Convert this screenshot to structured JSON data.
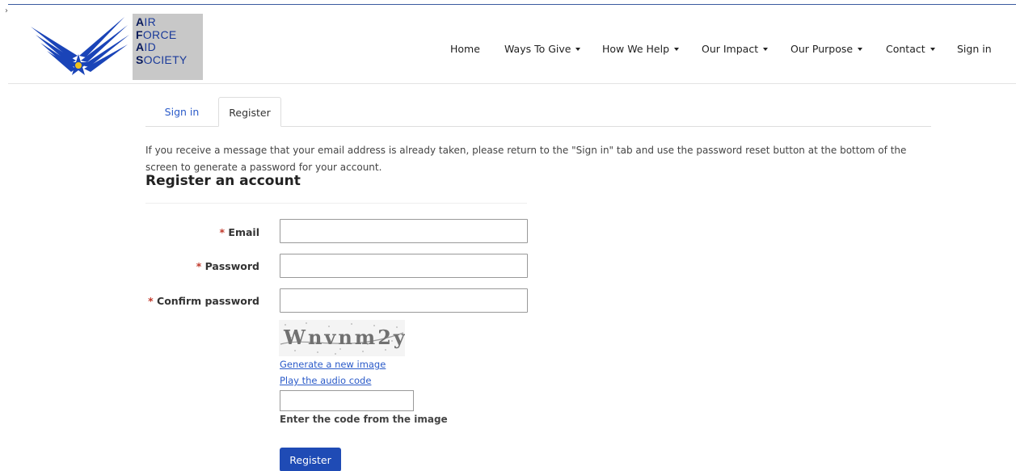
{
  "logo": {
    "lines": [
      {
        "cap": "A",
        "rest": "IR"
      },
      {
        "cap": "F",
        "rest": "ORCE"
      },
      {
        "cap": "A",
        "rest": "ID"
      },
      {
        "cap": "S",
        "rest": "OCIETY"
      }
    ]
  },
  "nav": {
    "items": [
      {
        "label": "Home",
        "dropdown": false
      },
      {
        "label": "Ways To Give",
        "dropdown": true
      },
      {
        "label": "How We Help",
        "dropdown": true
      },
      {
        "label": "Our Impact",
        "dropdown": true
      },
      {
        "label": "Our Purpose",
        "dropdown": true
      },
      {
        "label": "Contact",
        "dropdown": true
      },
      {
        "label": "Sign in",
        "dropdown": false
      }
    ]
  },
  "tabs": {
    "signin": "Sign in",
    "register": "Register",
    "active": "Register"
  },
  "info_text": "If you receive a message that your email address is already taken, please return to the \"Sign in\" tab and use the password reset button at the bottom of the screen to generate a password for your account.",
  "form": {
    "title": "Register an account",
    "required_marker": "*",
    "email_label": "Email",
    "email_value": "",
    "password_label": "Password",
    "password_value": "",
    "confirm_label": "Confirm password",
    "confirm_value": "",
    "captcha_text": "Wnvnm2y",
    "new_image_link": "Generate a new image",
    "audio_link": "Play the audio code",
    "captcha_value": "",
    "captcha_hint": "Enter the code from the image",
    "submit_label": "Register"
  },
  "colors": {
    "link": "#2b5bc9",
    "button": "#1f4bb5",
    "required": "#c0392b",
    "logo_blue": "#1a3a9a",
    "star": "#f2c21b"
  },
  "icons": [
    "wings-logo-icon",
    "star-icon",
    "caret-down-icon"
  ]
}
